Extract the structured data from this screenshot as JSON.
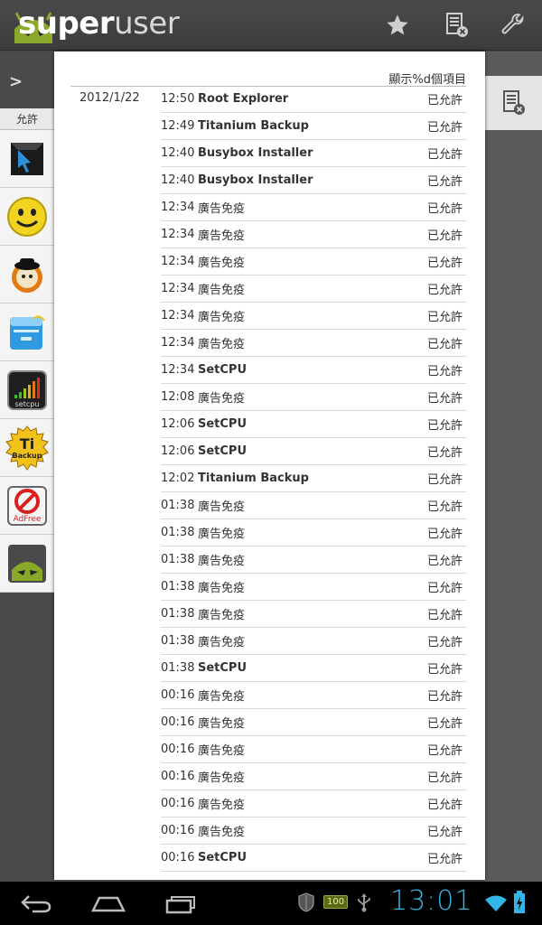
{
  "app": {
    "title_bold": "super",
    "title_light": "user",
    "logo_icon": "android-logo-icon"
  },
  "toolbar": {
    "star_icon": "star-icon",
    "log_icon": "log-clear-icon",
    "settings_icon": "wrench-icon"
  },
  "sidebar": {
    "chevron": ">",
    "tab_label": "允許",
    "apps": [
      {
        "name": "root-explorer-app-icon"
      },
      {
        "name": "smiley-app-icon"
      },
      {
        "name": "clockwork-app-icon"
      },
      {
        "name": "file-manager-app-icon"
      },
      {
        "name": "setcpu-app-icon",
        "label": "setcpu"
      },
      {
        "name": "titanium-backup-app-icon",
        "label_top": "Ti",
        "label_bottom": "Backup"
      },
      {
        "name": "adfree-app-icon",
        "label": "AdFree"
      },
      {
        "name": "superuser-app-icon"
      }
    ]
  },
  "dialog": {
    "header": "顯示%d個項目",
    "date": "2012/1/22",
    "rows": [
      {
        "time": "12:50",
        "app": "Root Explorer",
        "status": "已允許",
        "cjk": false
      },
      {
        "time": "12:49",
        "app": "Titanium Backup",
        "status": "已允許",
        "cjk": false
      },
      {
        "time": "12:40",
        "app": "Busybox Installer",
        "status": "已允許",
        "cjk": false
      },
      {
        "time": "12:40",
        "app": "Busybox Installer",
        "status": "已允許",
        "cjk": false
      },
      {
        "time": "12:34",
        "app": "廣告免疫",
        "status": "已允許",
        "cjk": true
      },
      {
        "time": "12:34",
        "app": "廣告免疫",
        "status": "已允許",
        "cjk": true
      },
      {
        "time": "12:34",
        "app": "廣告免疫",
        "status": "已允許",
        "cjk": true
      },
      {
        "time": "12:34",
        "app": "廣告免疫",
        "status": "已允許",
        "cjk": true
      },
      {
        "time": "12:34",
        "app": "廣告免疫",
        "status": "已允許",
        "cjk": true
      },
      {
        "time": "12:34",
        "app": "廣告免疫",
        "status": "已允許",
        "cjk": true
      },
      {
        "time": "12:34",
        "app": "SetCPU",
        "status": "已允許",
        "cjk": false
      },
      {
        "time": "12:08",
        "app": "廣告免疫",
        "status": "已允許",
        "cjk": true
      },
      {
        "time": "12:06",
        "app": "SetCPU",
        "status": "已允許",
        "cjk": false
      },
      {
        "time": "12:06",
        "app": "SetCPU",
        "status": "已允許",
        "cjk": false
      },
      {
        "time": "12:02",
        "app": "Titanium Backup",
        "status": "已允許",
        "cjk": false
      },
      {
        "time": "01:38",
        "app": "廣告免疫",
        "status": "已允許",
        "cjk": true
      },
      {
        "time": "01:38",
        "app": "廣告免疫",
        "status": "已允許",
        "cjk": true
      },
      {
        "time": "01:38",
        "app": "廣告免疫",
        "status": "已允許",
        "cjk": true
      },
      {
        "time": "01:38",
        "app": "廣告免疫",
        "status": "已允許",
        "cjk": true
      },
      {
        "time": "01:38",
        "app": "廣告免疫",
        "status": "已允許",
        "cjk": true
      },
      {
        "time": "01:38",
        "app": "廣告免疫",
        "status": "已允許",
        "cjk": true
      },
      {
        "time": "01:38",
        "app": "SetCPU",
        "status": "已允許",
        "cjk": false
      },
      {
        "time": "00:16",
        "app": "廣告免疫",
        "status": "已允許",
        "cjk": true
      },
      {
        "time": "00:16",
        "app": "廣告免疫",
        "status": "已允許",
        "cjk": true
      },
      {
        "time": "00:16",
        "app": "廣告免疫",
        "status": "已允許",
        "cjk": true
      },
      {
        "time": "00:16",
        "app": "廣告免疫",
        "status": "已允許",
        "cjk": true
      },
      {
        "time": "00:16",
        "app": "廣告免疫",
        "status": "已允許",
        "cjk": true
      },
      {
        "time": "00:16",
        "app": "廣告免疫",
        "status": "已允許",
        "cjk": true
      },
      {
        "time": "00:16",
        "app": "SetCPU",
        "status": "已允許",
        "cjk": false
      }
    ]
  },
  "navbar": {
    "back_icon": "back-icon",
    "home_icon": "home-icon",
    "recents_icon": "recent-apps-icon"
  },
  "status": {
    "shield_icon": "shield-icon",
    "battery_badge": "100",
    "usb_icon": "usb-icon",
    "time": "13:01",
    "wifi_icon": "wifi-icon",
    "battery_icon": "battery-charging-icon"
  },
  "colors": {
    "accent": "#33b5e5",
    "actionbar": "#3c3c3c"
  }
}
